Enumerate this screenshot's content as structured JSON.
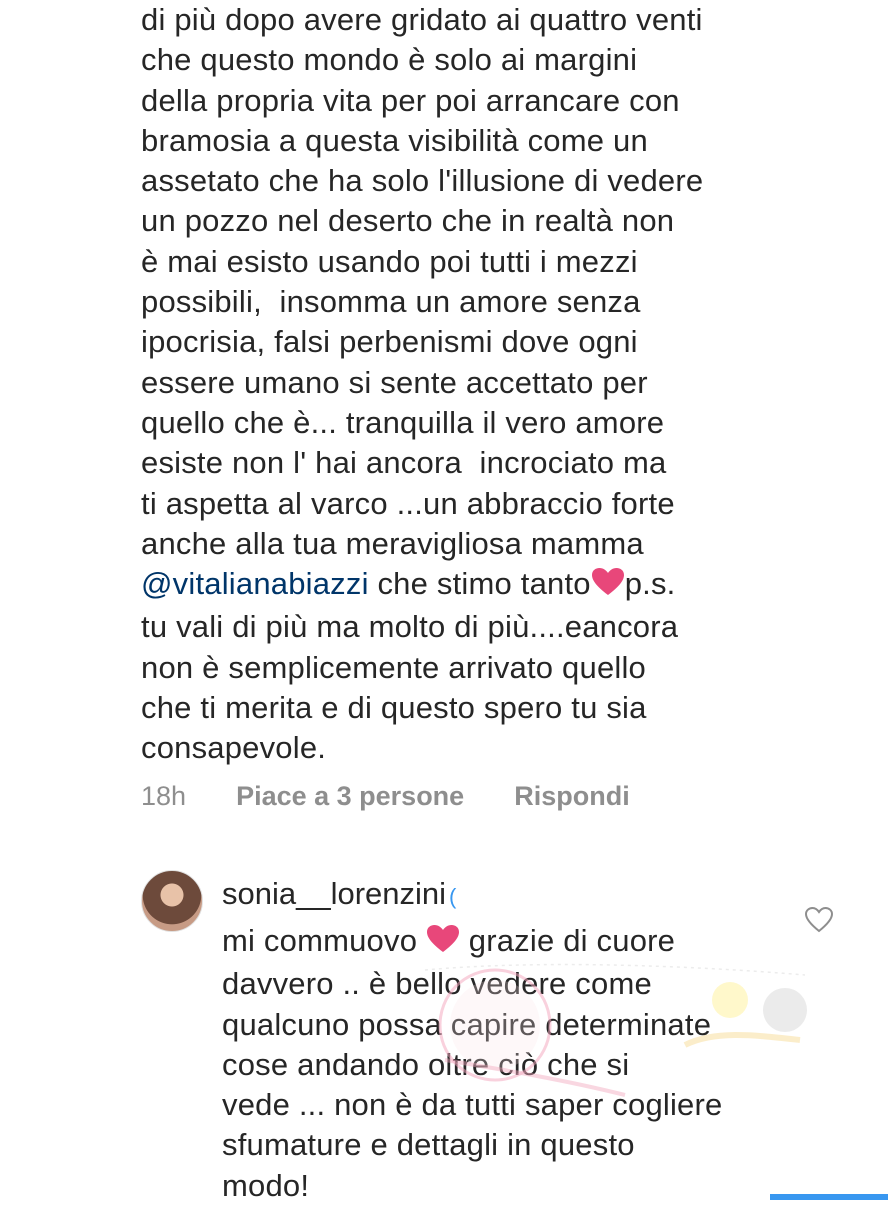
{
  "comment": {
    "lines": [
      "di più dopo avere gridato ai quattro venti",
      "che questo mondo è solo ai margini",
      "della propria vita per poi arrancare con",
      "bramosia a questa visibilità come un",
      "assetato che ha solo l'illusione di vedere",
      "un pozzo nel deserto che in realtà non",
      "è mai esisto usando poi tutti i mezzi",
      "possibili,  insomma un amore senza",
      "ipocrisia, falsi perbenismi dove ogni",
      "essere umano si sente accettato per",
      "quello che è... tranquilla il vero amore",
      "esiste non l' hai ancora  incrociato ma",
      "ti aspetta al varco ...un abbraccio forte",
      "anche alla tua meravigliosa mamma"
    ],
    "mention": "@vitalianabiazzi",
    "mention_after": " che stimo tanto",
    "mention_tail": "p.s.",
    "lines_after": [
      "tu vali di più ma molto di più....eancora",
      "non è semplicemente arrivato quello",
      "che ti merita e di questo spero tu sia",
      "consapevole."
    ],
    "time": "18h",
    "likes": "Piace a 3 persone",
    "reply": "Rispondi"
  },
  "reply_comment": {
    "username": "sonia__lorenzini",
    "verified_glyph": "(",
    "first_line_start": "mi commuovo ",
    "first_line_end": " grazie di cuore",
    "lines": [
      "davvero .. è bello vedere come",
      "qualcuno possa capire determinate",
      "cose andando oltre ciò che si",
      "vede ... non è da tutti saper cogliere",
      "sfumature e dettagli in questo",
      "modo!"
    ],
    "like_icon": "heart-outline-icon"
  },
  "colors": {
    "text": "#262626",
    "muted": "#8e8e8e",
    "mention": "#003569",
    "heart": "#e8477a",
    "accent": "#3897f0"
  }
}
